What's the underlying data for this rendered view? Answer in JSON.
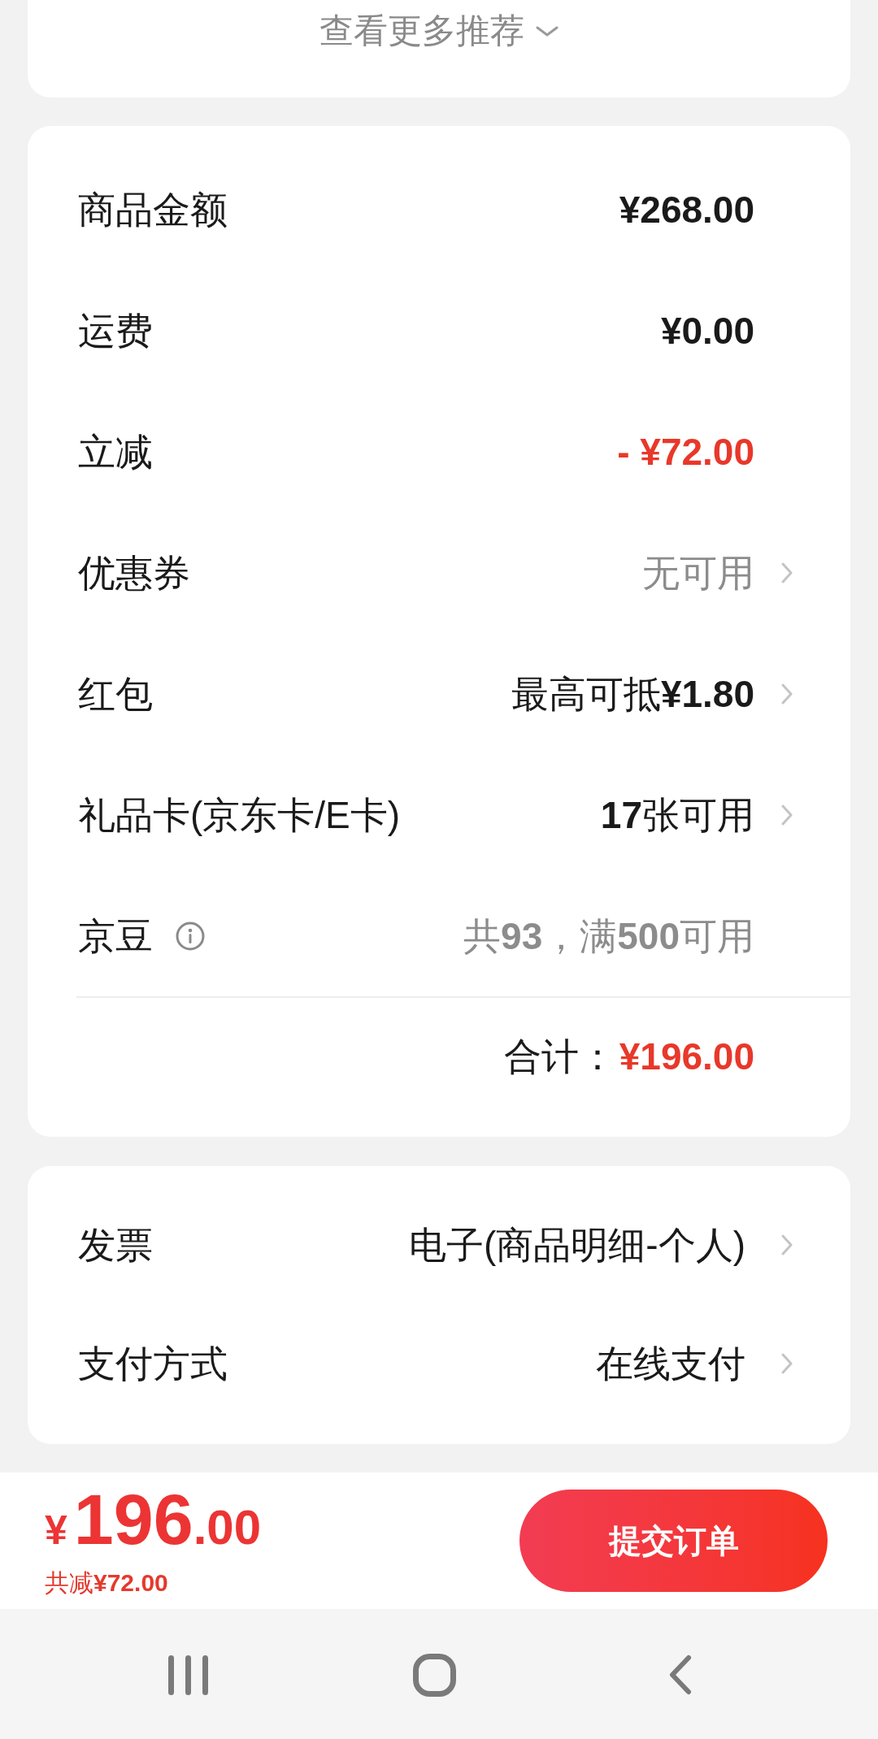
{
  "recommendations": {
    "more_link": "查看更多推荐"
  },
  "price_summary": {
    "rows": [
      {
        "kind": "amount",
        "label": "商品金额",
        "value": "¥268.00",
        "info": false,
        "arrow": false
      },
      {
        "kind": "amount",
        "label": "运费",
        "value": "¥0.00",
        "info": false,
        "arrow": false
      },
      {
        "kind": "discount",
        "label": "立减",
        "value": "- ¥72.00",
        "info": false,
        "arrow": false
      },
      {
        "kind": "note",
        "label": "优惠券",
        "value": "无可用",
        "info": false,
        "arrow": true
      },
      {
        "kind": "option",
        "label": "红包",
        "value": "最高可抵**¥1.80**",
        "info": false,
        "arrow": true
      },
      {
        "kind": "option",
        "label": "礼品卡(京东卡/E卡)",
        "value": "**17**张可用",
        "info": false,
        "arrow": true
      },
      {
        "kind": "note",
        "label": "京豆",
        "value": "共**93**，满**500**可用",
        "info": true,
        "arrow": false
      }
    ],
    "total": {
      "label": "合计：",
      "value": "¥196.00"
    }
  },
  "order_options": {
    "rows": [
      {
        "label": "发票",
        "value": "电子(商品明细-个人)",
        "arrow": true
      },
      {
        "label": "支付方式",
        "value": "在线支付",
        "arrow": true
      }
    ]
  },
  "checkout_bar": {
    "price": {
      "currency": "¥",
      "integer": "196",
      "decimals": ".00"
    },
    "savings": "共减**¥72.00**",
    "submit_button": "提交订单"
  }
}
